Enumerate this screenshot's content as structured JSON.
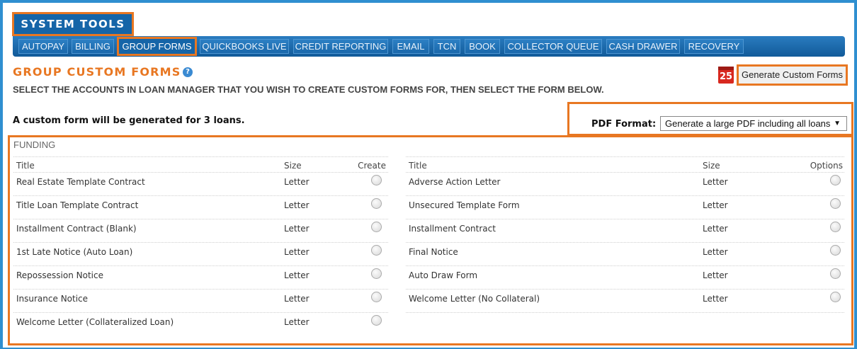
{
  "header": {
    "system_tools_label": "SYSTEM TOOLS"
  },
  "nav": {
    "tabs": [
      {
        "label": "AUTOPAY"
      },
      {
        "label": "BILLING"
      },
      {
        "label": "GROUP FORMS",
        "active": true
      },
      {
        "label": "QUICKBOOKS LIVE"
      },
      {
        "label": "CREDIT REPORTING"
      },
      {
        "label": "EMAIL"
      },
      {
        "label": "TCN"
      },
      {
        "label": "BOOK"
      },
      {
        "label": "COLLECTOR QUEUE"
      },
      {
        "label": "CASH DRAWER"
      },
      {
        "label": "RECOVERY"
      }
    ]
  },
  "page": {
    "title": "GROUP CUSTOM FORMS",
    "help_icon": "?",
    "subtitle": "SELECT THE ACCOUNTS IN LOAN MANAGER THAT YOU WISH TO CREATE CUSTOM FORMS FOR, THEN SELECT THE FORM BELOW.",
    "calendar_day": "25",
    "generate_button": "Generate Custom Forms",
    "loan_note": "A custom form will be generated for 3 loans."
  },
  "pdf": {
    "label": "PDF Format:",
    "selected": "Generate a large PDF including all loans"
  },
  "funding": {
    "section_label": "FUNDING",
    "left_table": {
      "headers": {
        "title": "Title",
        "size": "Size",
        "option": "Create"
      },
      "rows": [
        {
          "title": "Real Estate Template Contract",
          "size": "Letter"
        },
        {
          "title": "Title Loan Template Contract",
          "size": "Letter"
        },
        {
          "title": "Installment Contract (Blank)",
          "size": "Letter"
        },
        {
          "title": "1st Late Notice (Auto Loan)",
          "size": "Letter"
        },
        {
          "title": "Repossession Notice",
          "size": "Letter"
        },
        {
          "title": "Insurance Notice",
          "size": "Letter"
        },
        {
          "title": "Welcome Letter (Collateralized Loan)",
          "size": "Letter"
        }
      ]
    },
    "right_table": {
      "headers": {
        "title": "Title",
        "size": "Size",
        "option": "Options"
      },
      "rows": [
        {
          "title": "Adverse Action Letter",
          "size": "Letter"
        },
        {
          "title": "Unsecured Template Form",
          "size": "Letter"
        },
        {
          "title": "Installment Contract",
          "size": "Letter"
        },
        {
          "title": "Final Notice",
          "size": "Letter"
        },
        {
          "title": "Auto Draw Form",
          "size": "Letter"
        },
        {
          "title": "Welcome Letter (No Collateral)",
          "size": "Letter"
        }
      ]
    }
  },
  "colors": {
    "accent_orange": "#e87722",
    "nav_blue": "#1565a8",
    "page_border_blue": "#2f8fd0"
  }
}
